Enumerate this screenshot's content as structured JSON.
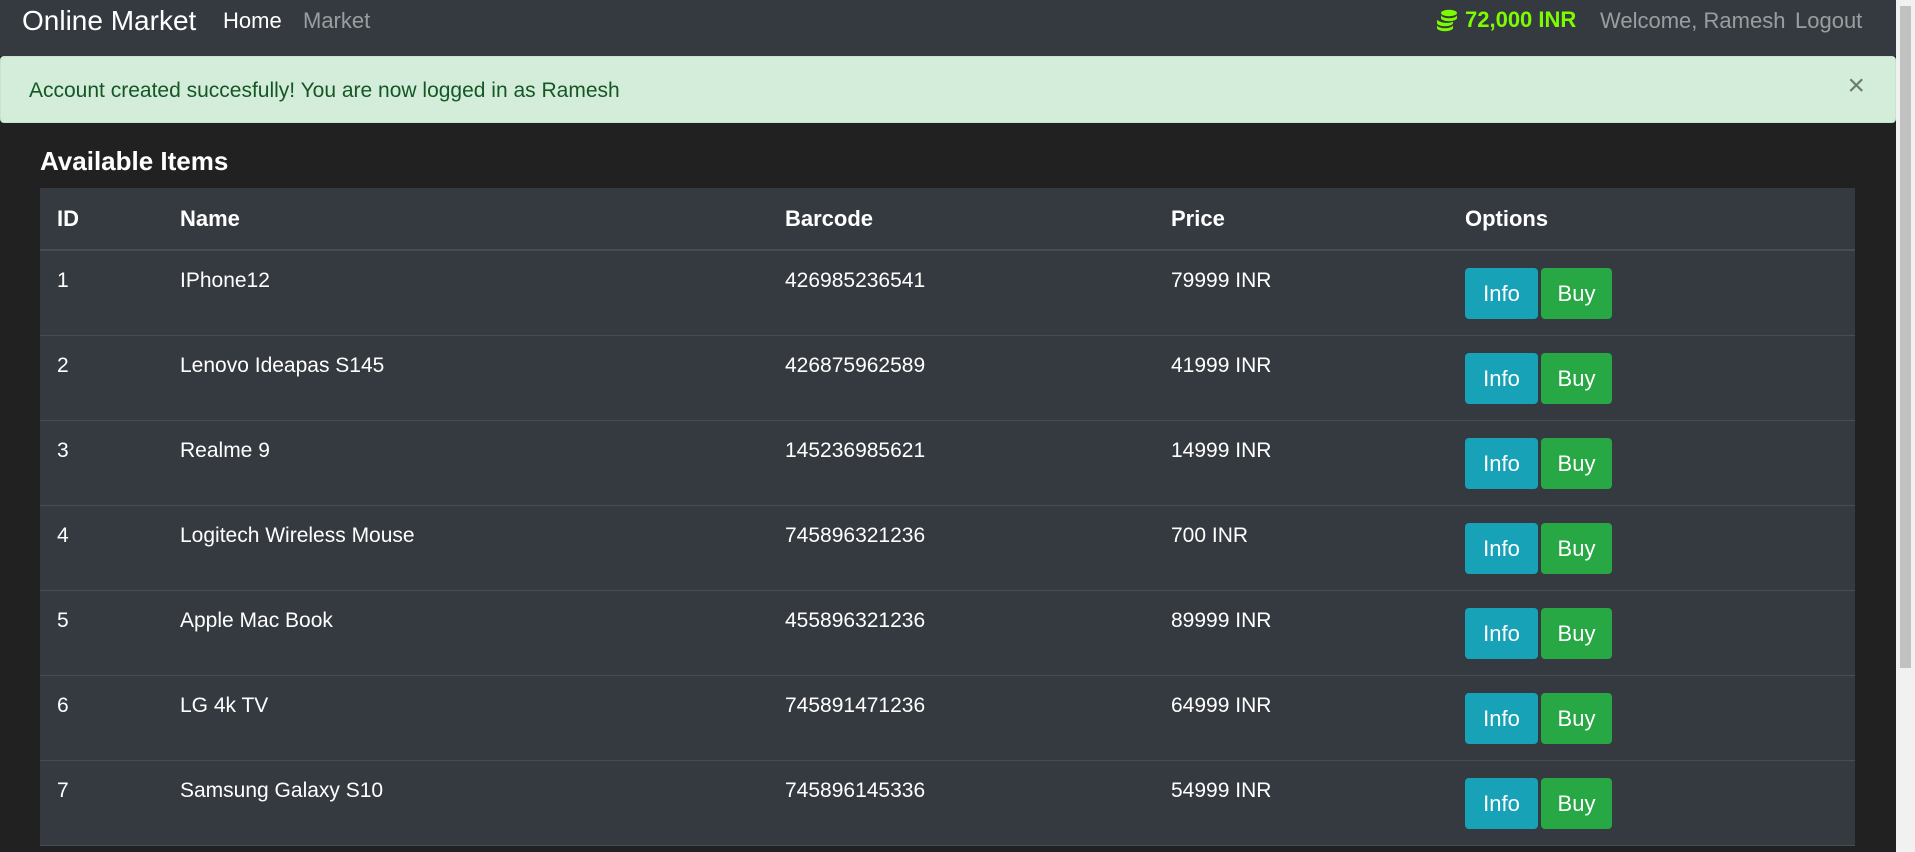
{
  "navbar": {
    "brand": "Online Market",
    "links": [
      {
        "label": "Home"
      },
      {
        "label": "Market"
      }
    ],
    "budget": "72,000 INR",
    "welcome": "Welcome, Ramesh",
    "logout": "Logout"
  },
  "alert": {
    "message": "Account created succesfully! You are now logged in as Ramesh",
    "close": "×"
  },
  "main": {
    "title": "Available Items",
    "columns": [
      "ID",
      "Name",
      "Barcode",
      "Price",
      "Options"
    ],
    "info_label": "Info",
    "buy_label": "Buy",
    "rows": [
      {
        "id": "1",
        "name": "IPhone12",
        "barcode": "426985236541",
        "price": "79999 INR"
      },
      {
        "id": "2",
        "name": "Lenovo Ideapas S145",
        "barcode": "426875962589",
        "price": "41999 INR"
      },
      {
        "id": "3",
        "name": "Realme 9",
        "barcode": "145236985621",
        "price": "14999 INR"
      },
      {
        "id": "4",
        "name": "Logitech Wireless Mouse",
        "barcode": "745896321236",
        "price": "700 INR"
      },
      {
        "id": "5",
        "name": "Apple Mac Book",
        "barcode": "455896321236",
        "price": "89999 INR"
      },
      {
        "id": "6",
        "name": "LG 4k TV",
        "barcode": "745891471236",
        "price": "64999 INR"
      },
      {
        "id": "7",
        "name": "Samsung Galaxy S10",
        "barcode": "745896145336",
        "price": "54999 INR"
      }
    ]
  },
  "colors": {
    "navbar_bg": "#343a40",
    "page_bg": "#212121",
    "budget": "#7cfc00",
    "alert_bg": "#d4edda",
    "alert_text": "#155724",
    "info_button": "#17a2b8",
    "buy_button": "#28a745"
  },
  "icons": {
    "budget": "coins-icon",
    "alert_close": "close-icon"
  }
}
